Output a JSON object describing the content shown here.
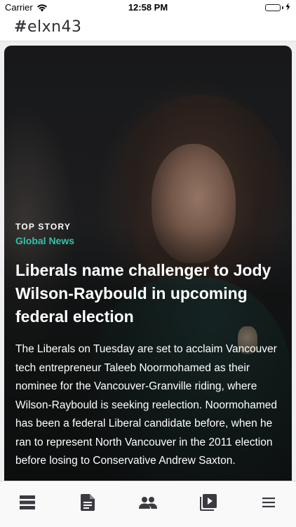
{
  "status_bar": {
    "carrier": "Carrier",
    "time": "12:58 PM",
    "battery_level": 1.0
  },
  "header": {
    "logo_hash": "#",
    "logo_text": "elxn43"
  },
  "story": {
    "label": "TOP STORY",
    "source": "Global News",
    "headline": "Liberals name challenger to Jody Wilson-Raybould in upcoming federal election",
    "summary": "The Liberals on Tuesday are set to acclaim Vancouver tech entrepreneur Taleeb Noormohamed as their nominee for the Vancouver-Granville riding, where Wilson-Raybould is seeking reelection. Noormohamed has been a federal Liberal candidate before, when he ran to represent North Vancouver in the 2011 election before losing to Conservative Andrew Saxton."
  },
  "colors": {
    "accent": "#2ec4a5",
    "tab_icon": "#3a3a40"
  },
  "tab_bar": {
    "tabs": [
      {
        "icon": "feed-icon"
      },
      {
        "icon": "document-icon"
      },
      {
        "icon": "people-icon"
      },
      {
        "icon": "video-library-icon"
      },
      {
        "icon": "menu-icon"
      }
    ]
  }
}
